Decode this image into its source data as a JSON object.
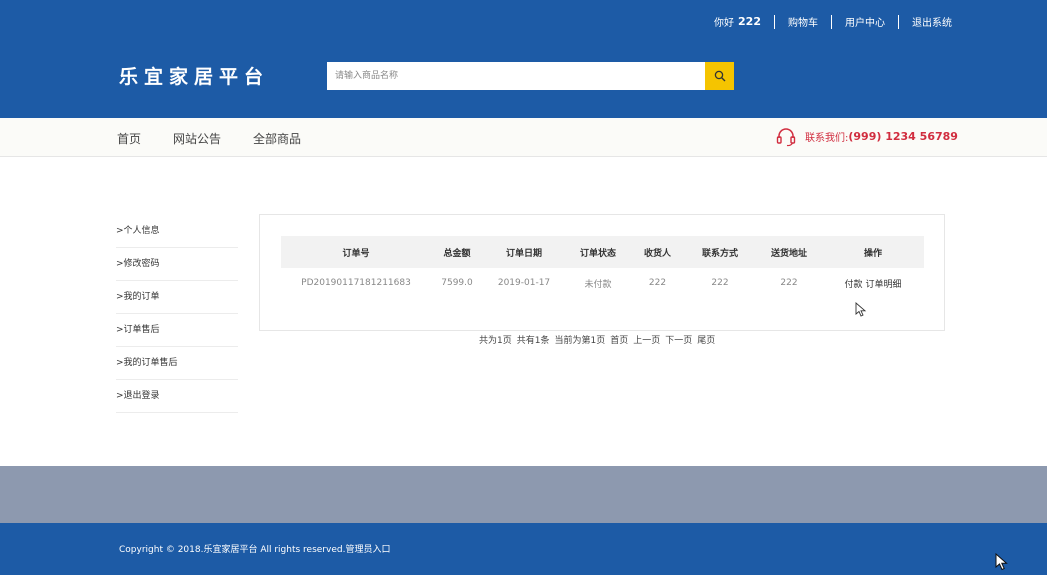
{
  "topbar": {
    "greeting": "你好",
    "username": "222",
    "cart": "购物车",
    "user_center": "用户中心",
    "logout": "退出系统"
  },
  "header": {
    "logo": "乐宜家居平台",
    "search_placeholder": "请输入商品名称"
  },
  "nav": {
    "items": [
      "首页",
      "网站公告",
      "全部商品"
    ],
    "contact_label": "联系我们:",
    "contact_phone": "(999) 1234 56789"
  },
  "sidebar": {
    "items": [
      ">个人信息",
      ">修改密码",
      ">我的订单",
      ">订单售后",
      ">我的订单售后",
      ">退出登录"
    ]
  },
  "orders": {
    "headers": [
      "订单号",
      "总金额",
      "订单日期",
      "订单状态",
      "收货人",
      "联系方式",
      "送货地址",
      "操作"
    ],
    "rows": [
      {
        "order_no": "PD20190117181211683",
        "total": "7599.0",
        "date": "2019-01-17",
        "status": "未付款",
        "receiver": "222",
        "phone": "222",
        "address": "222",
        "action_pay": "付款",
        "action_detail": "订单明细"
      }
    ]
  },
  "pagination": {
    "total_pages": "共为1页",
    "total_items": "共有1条",
    "current": "当前为第1页",
    "first": "首页",
    "prev": "上一页",
    "next": "下一页",
    "last": "尾页"
  },
  "footer": {
    "copyright": "Copyright © 2018.乐宜家居平台 All rights reserved.管理员入口"
  },
  "colors": {
    "brand_blue": "#1d5ba6",
    "accent_yellow": "#f5c400",
    "contact_red": "#d12d3f",
    "band_gray": "#8d99af"
  }
}
